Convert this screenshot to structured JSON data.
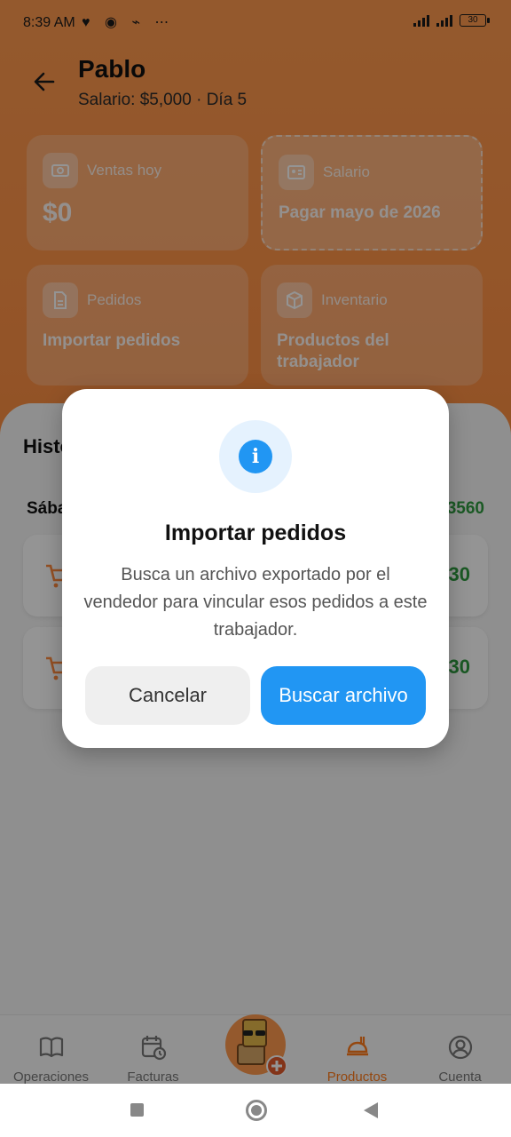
{
  "status_bar": {
    "time": "8:39 AM",
    "battery": "30",
    "icons": "♥ ◉ ⌁ ⋯"
  },
  "header": {
    "title": "Pablo",
    "subtitle": "Salario: $5,000 · Día 5"
  },
  "cards": {
    "sales": {
      "label": "Ventas hoy",
      "value": "$0"
    },
    "salary": {
      "label": "Salario",
      "value": "Pagar mayo de 2026"
    },
    "orders": {
      "label": "Pedidos",
      "value": "Importar pedidos"
    },
    "inventory": {
      "label": "Inventario",
      "value": "Productos del trabajador"
    }
  },
  "history": {
    "title_partial": "Histo",
    "day_label_partial": "Sába",
    "day_total_partial": "3560",
    "rows": [
      {
        "amount_partial": "30"
      },
      {
        "amount_partial": "30"
      }
    ]
  },
  "bottom_nav": {
    "items": [
      "Operaciones",
      "Facturas",
      "Productos",
      "Cuenta"
    ],
    "active": "Productos"
  },
  "dialog": {
    "title": "Importar pedidos",
    "body": "Busca un archivo exportado por el vendedor para vincular esos pedidos a este trabajador.",
    "cancel_label": "Cancelar",
    "confirm_label": "Buscar archivo",
    "icon_glyph": "i"
  },
  "colors": {
    "accent_orange": "#ff9347",
    "primary_blue": "#2196f3",
    "success_green": "#2e9a3e"
  }
}
